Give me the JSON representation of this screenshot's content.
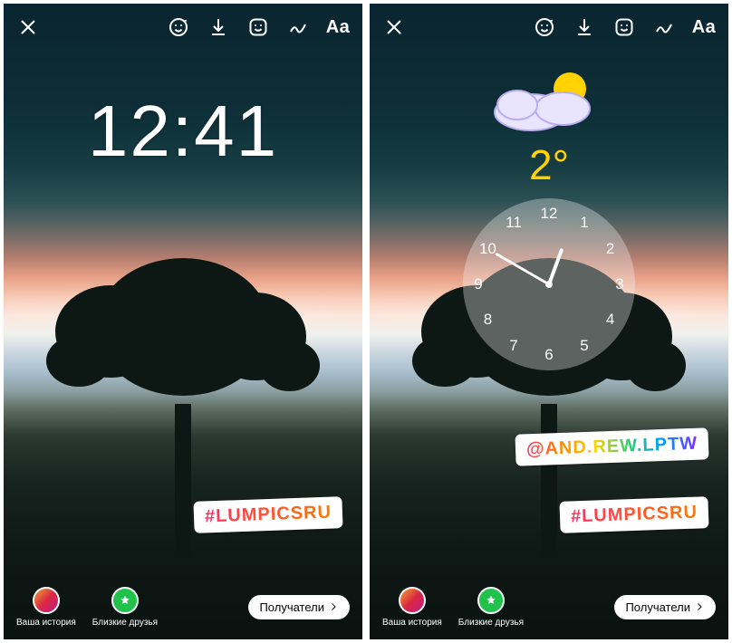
{
  "topbar": {
    "text_tool": "Aa"
  },
  "left": {
    "time": "12:41",
    "hashtag": "#LUMPICSRU"
  },
  "right": {
    "temperature": "2°",
    "clock_numbers": [
      "12",
      "1",
      "2",
      "3",
      "4",
      "5",
      "6",
      "7",
      "8",
      "9",
      "10",
      "11"
    ],
    "mention": "@AND.REW.LPTW",
    "hashtag": "#LUMPICSRU"
  },
  "bottom": {
    "your_story": "Ваша история",
    "close_friends": "Близкие друзья",
    "recipients": "Получатели"
  }
}
